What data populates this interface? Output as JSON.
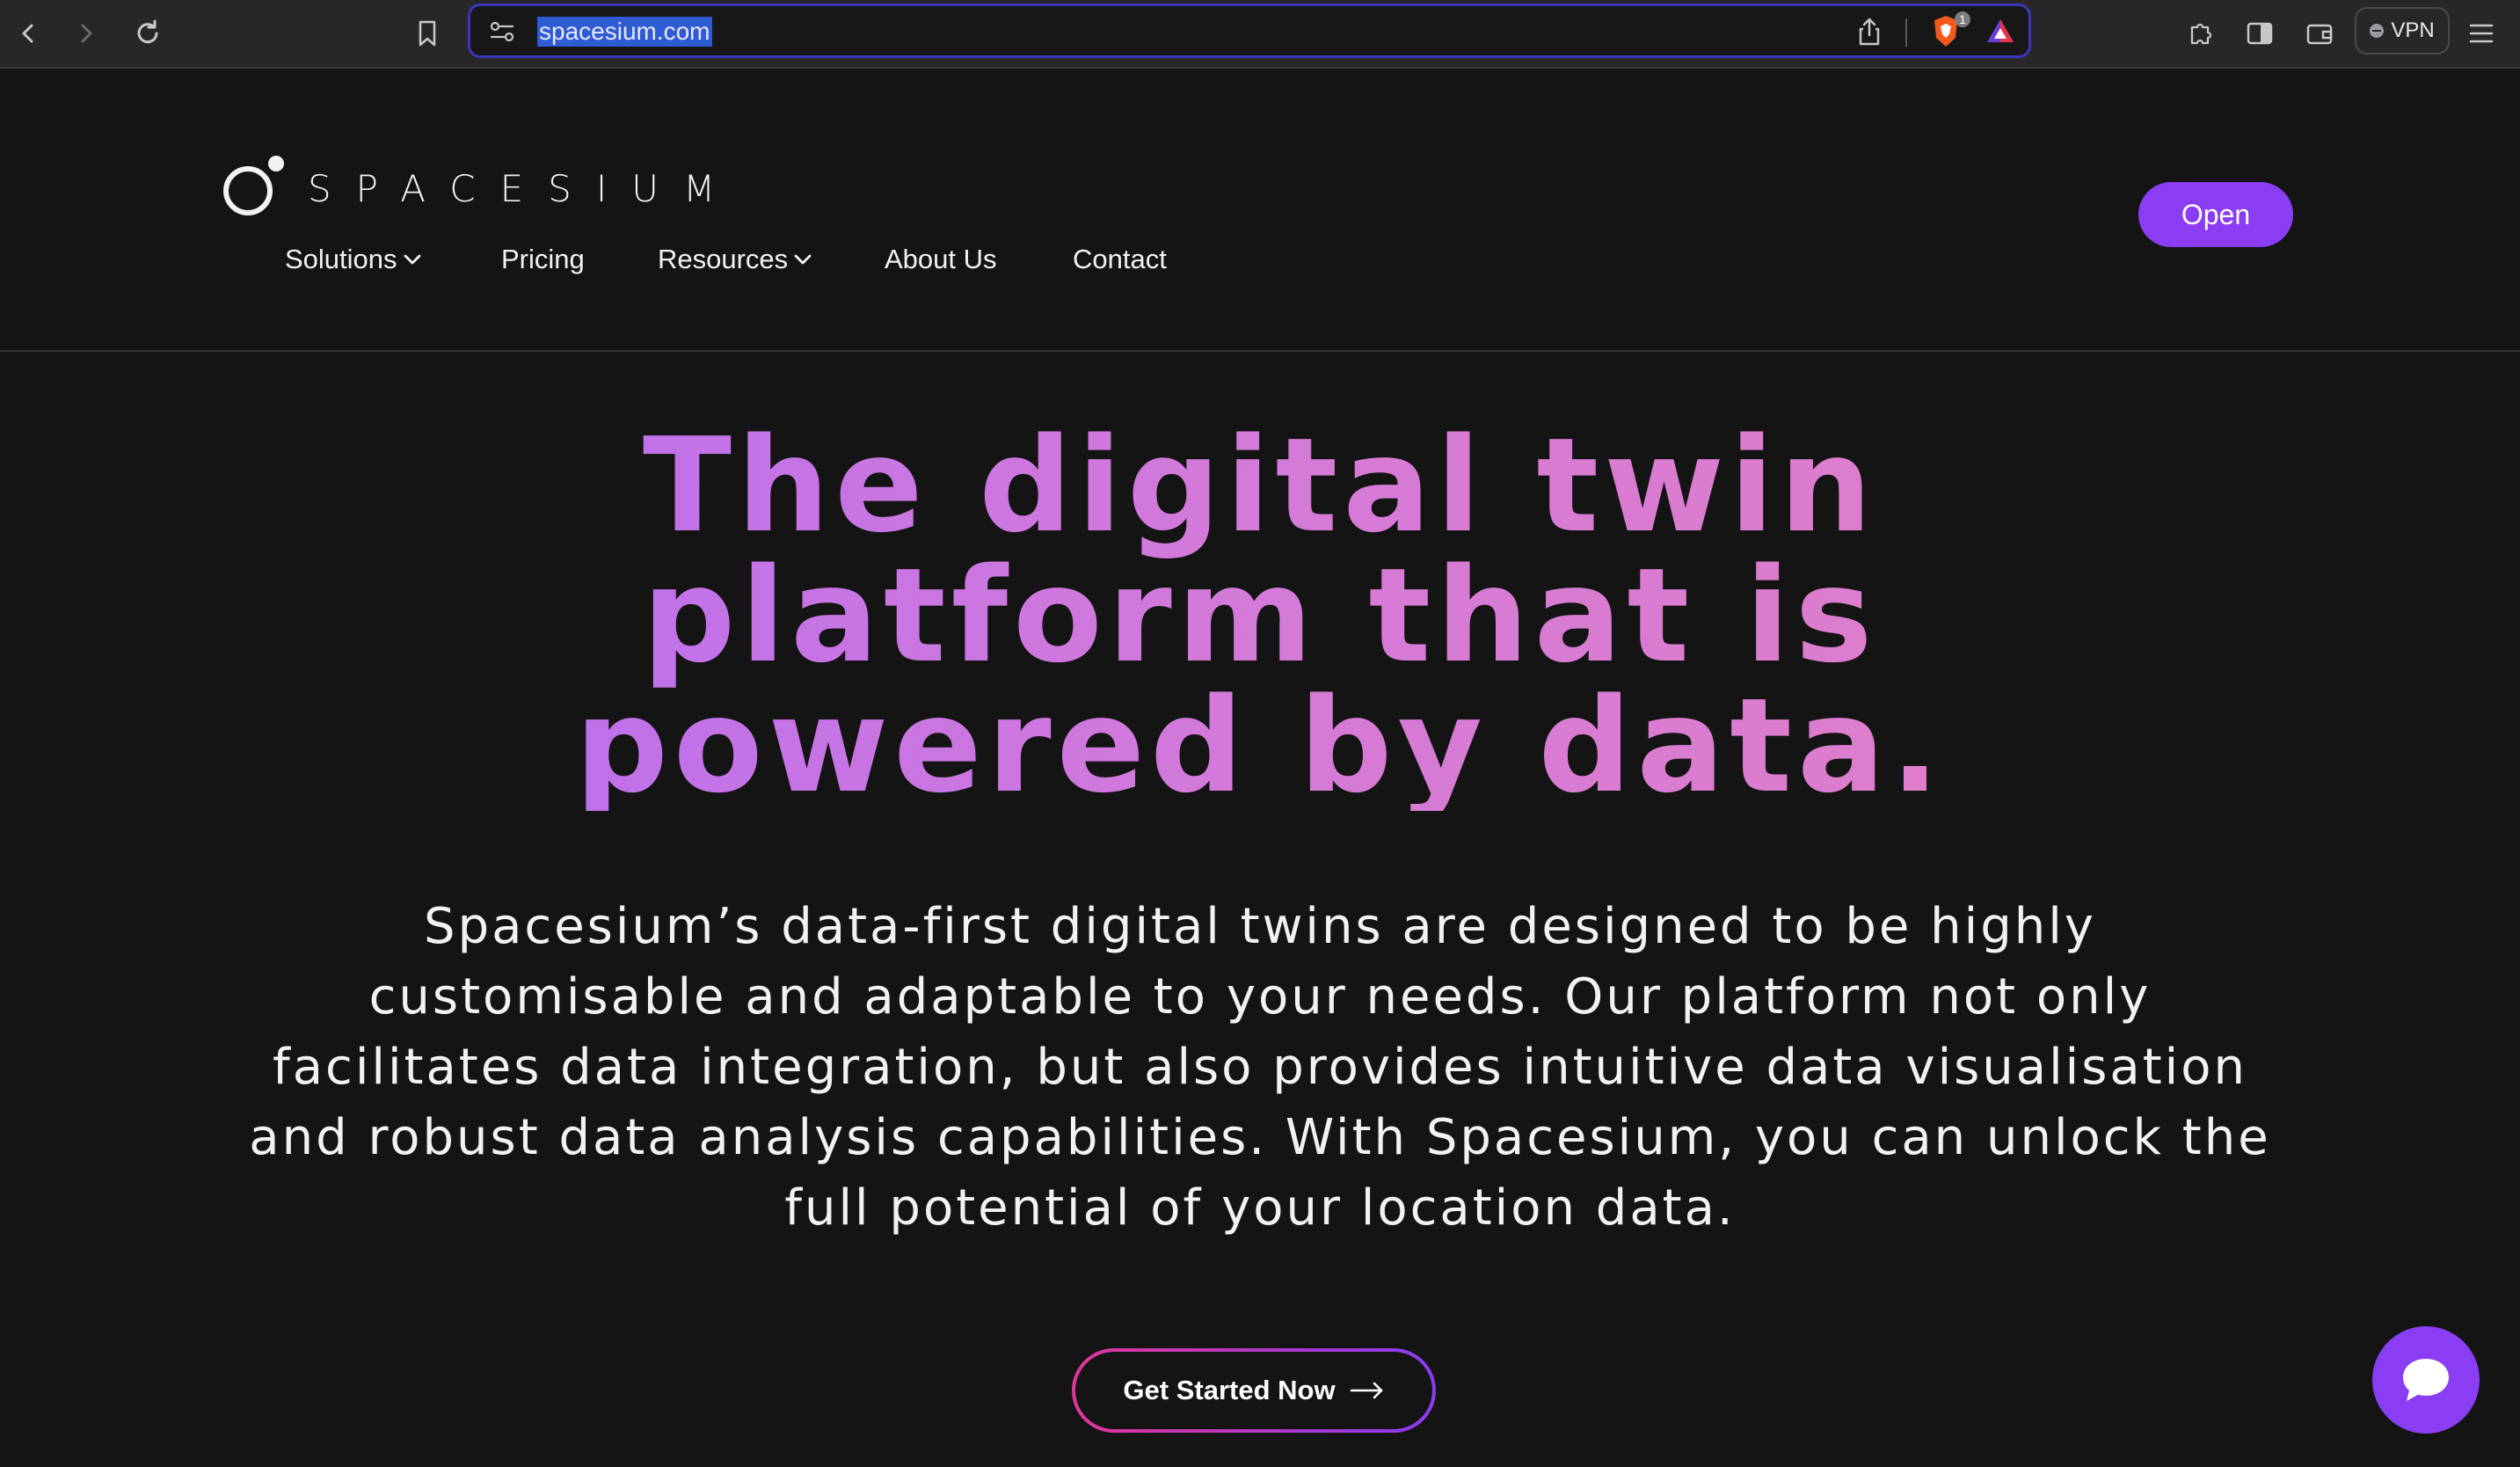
{
  "browser": {
    "url": "spacesium.com",
    "shield_count": "1",
    "vpn_label": "VPN",
    "accent_color": "#3d36b8"
  },
  "header": {
    "logo_text": "SPACESIUM",
    "nav": [
      {
        "label": "Solutions",
        "has_dropdown": true
      },
      {
        "label": "Pricing",
        "has_dropdown": false
      },
      {
        "label": "Resources",
        "has_dropdown": true
      },
      {
        "label": "About Us",
        "has_dropdown": false
      },
      {
        "label": "Contact",
        "has_dropdown": false
      }
    ],
    "open_label": "Open"
  },
  "hero": {
    "title_lines": [
      "The digital twin",
      "platform that is",
      "powered by data."
    ],
    "description": "Spacesium’s data-first digital twins are designed to be highly customisable and adaptable to your needs. Our platform not only facilitates data integration, but also provides intuitive data visualisation and robust data analysis capabilities. With Spacesium, you can unlock the full potential of your location data.",
    "cta_label": "Get Started Now"
  },
  "colors": {
    "brand_purple": "#8a3df2",
    "gradient_start": "#b96ef0",
    "gradient_end": "#e07ec8",
    "cta_border_pink": "#e0359a",
    "background": "#141414"
  },
  "icons": {
    "back": "chevron-left-icon",
    "forward": "chevron-right-icon",
    "reload": "reload-icon",
    "bookmark": "bookmark-icon",
    "site_settings": "site-settings-icon",
    "share": "share-icon",
    "brave_shield": "brave-shield-icon",
    "rewards": "brave-rewards-icon",
    "extensions": "puzzle-icon",
    "sidebar": "sidebar-icon",
    "wallet": "wallet-icon",
    "menu": "hamburger-menu-icon",
    "chat": "chat-bubble-icon",
    "arrow": "arrow-right-icon"
  }
}
